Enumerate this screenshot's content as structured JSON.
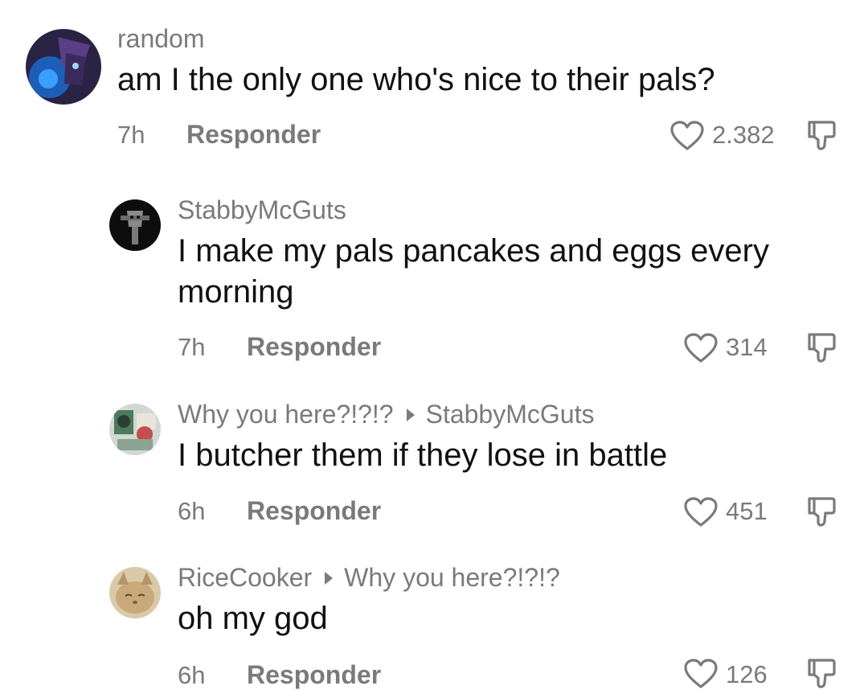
{
  "comments": [
    {
      "username": "random",
      "text": "am I the only one who's nice to their pals?",
      "time": "7h",
      "reply_label": "Responder",
      "likes": "2.382",
      "avatar_icon": "purple-character-avatar"
    },
    {
      "username": "StabbyMcGuts",
      "text": "I make my pals pancakes and eggs every morning",
      "time": "7h",
      "reply_label": "Responder",
      "likes": "314",
      "avatar_icon": "dark-skull-avatar"
    },
    {
      "username": "Why you here?!?!?",
      "reply_to": "StabbyMcGuts",
      "text": "I butcher them if they lose in battle",
      "time": "6h",
      "reply_label": "Responder",
      "likes": "451",
      "avatar_icon": "comic-character-avatar"
    },
    {
      "username": "RiceCooker",
      "reply_to": "Why you here?!?!?",
      "text": "oh my god",
      "time": "6h",
      "reply_label": "Responder",
      "likes": "126",
      "avatar_icon": "cat-face-avatar"
    }
  ]
}
